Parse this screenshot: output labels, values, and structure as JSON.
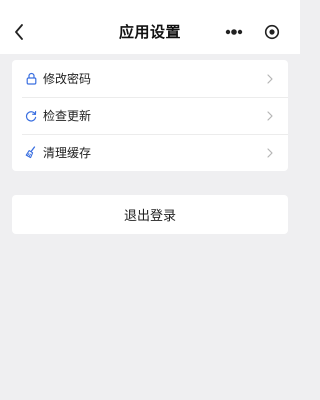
{
  "nav": {
    "title": "应用设置",
    "back_icon": "chevron-left-icon",
    "more_icon": "more-dots-icon",
    "close_icon": "target-close-icon"
  },
  "settings": {
    "items": [
      {
        "label": "修改密码",
        "icon": "lock-icon"
      },
      {
        "label": "检查更新",
        "icon": "refresh-icon"
      },
      {
        "label": "清理缓存",
        "icon": "broom-icon"
      }
    ],
    "accent_color": "#3a6fe0"
  },
  "logout": {
    "label": "退出登录"
  }
}
